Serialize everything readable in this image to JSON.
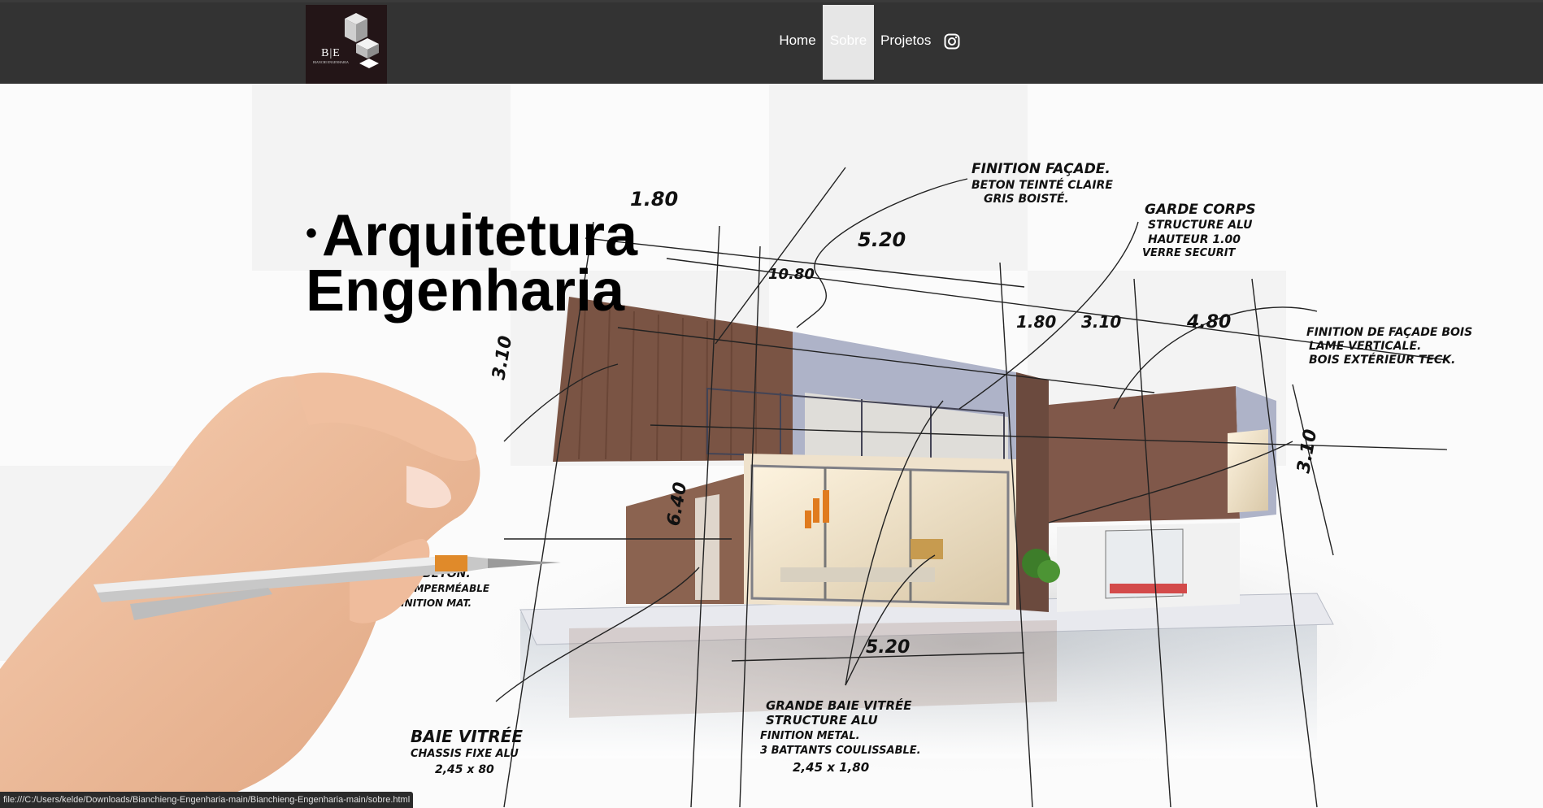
{
  "brand": {
    "logo_text": "B|E",
    "logo_subtext": "BIANCHI ENGENHARIA"
  },
  "nav": {
    "items": [
      {
        "label": "Home"
      },
      {
        "label": "Sobre",
        "active": true
      },
      {
        "label": "Projetos"
      }
    ],
    "instagram_icon": "instagram-icon"
  },
  "hero": {
    "lines": [
      "Arquitetura",
      "Engenharia"
    ],
    "bullet": "•",
    "sketch_notes": {
      "facade": [
        "FINITION FAÇADE.",
        "BETON TEINTÉ CLAIRE",
        "GRIS BOISTÉ."
      ],
      "garde_corps": [
        "GARDE CORPS",
        "STRUCTURE ALU",
        "HAUTEUR 1.00",
        "VERRE SECURIT"
      ],
      "facade_bois": [
        "FINITION DE FAÇADE BOIS",
        "LAME VERTICALE.",
        "BOIS EXTÉRIEUR TECK."
      ],
      "baie_vitree": [
        "BAIE VITRÉE",
        "CHASSIS FIXE ALU",
        "2,45 x 80"
      ],
      "grande_baie": [
        "GRANDE BAIE VITRÉE",
        "STRUCTURE ALU",
        "FINITION METAL.",
        "3 BATTANTS COULISSABLE.",
        "2,45 x 1,80"
      ],
      "beton": [
        "BETON.",
        "IMPERMÉABLE",
        "FINITION MAT."
      ],
      "dims": [
        "1.80",
        "5.20",
        "10.80",
        "1.80",
        "3.10",
        "4.80",
        "3.10",
        "3.10",
        "6.40",
        "5.20"
      ]
    }
  },
  "statusbar": {
    "url": "file:///C:/Users/kelde/Downloads/Bianchieng-Engenharia-main/Bianchieng-Engenharia-main/sobre.html"
  },
  "colors": {
    "nav_bg": "#333333",
    "active_bg": "#e6e6e6",
    "logo_bg": "#231517",
    "wood": "#7a5444"
  }
}
